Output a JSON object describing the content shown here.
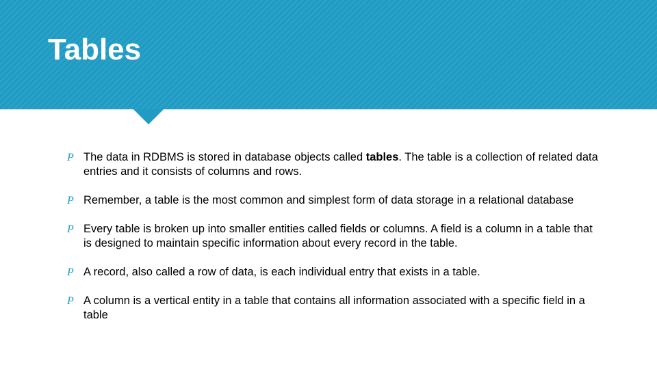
{
  "header": {
    "title": "Tables",
    "accent_color": "#1f9bc4"
  },
  "bullets": [
    {
      "prefix": "The data in RDBMS is stored in database objects called ",
      "bold": "tables",
      "suffix": ". The table is a collection of related data entries and it consists of columns and rows."
    },
    {
      "prefix": "Remember, a table is the most common and simplest form of data storage in a relational database",
      "bold": "",
      "suffix": ""
    },
    {
      "prefix": "Every table is broken up into smaller entities called fields or columns. A field is a column in a table that is designed to maintain specific information about every record in the table.",
      "bold": "",
      "suffix": ""
    },
    {
      "prefix": "A record, also called a row of data, is each individual entry that exists in a table.",
      "bold": "",
      "suffix": ""
    },
    {
      "prefix": "A column is a vertical entity in a table that contains all information associated with a specific field in a table",
      "bold": "",
      "suffix": ""
    }
  ],
  "bullet_glyph": "P"
}
